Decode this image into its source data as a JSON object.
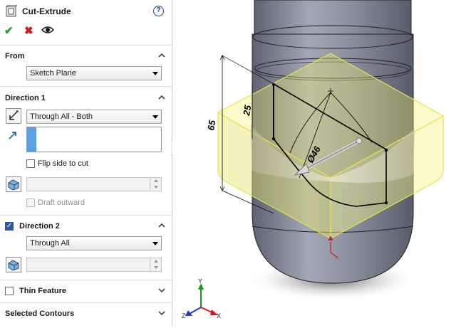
{
  "feature": {
    "title": "Cut-Extrude",
    "help": "?"
  },
  "from": {
    "label": "From",
    "value": "Sketch Plane"
  },
  "direction1": {
    "label": "Direction 1",
    "end_condition": "Through All - Both",
    "flip_label": "Flip side to cut",
    "draft_label": "Draft outward"
  },
  "direction2": {
    "label": "Direction 2",
    "end_condition": "Through All"
  },
  "thin_feature": {
    "label": "Thin Feature"
  },
  "selected_contours": {
    "label": "Selected Contours"
  },
  "dimensions": {
    "d1": "25",
    "d2": "65",
    "d3": "Ø46"
  },
  "triad": {
    "x": "X",
    "y": "Y",
    "z": "Z"
  },
  "colors": {
    "accent": "#2a5aa6",
    "ok": "#1a9a1a",
    "cancel": "#cc1a1a",
    "highlight": "#f5f36a"
  }
}
